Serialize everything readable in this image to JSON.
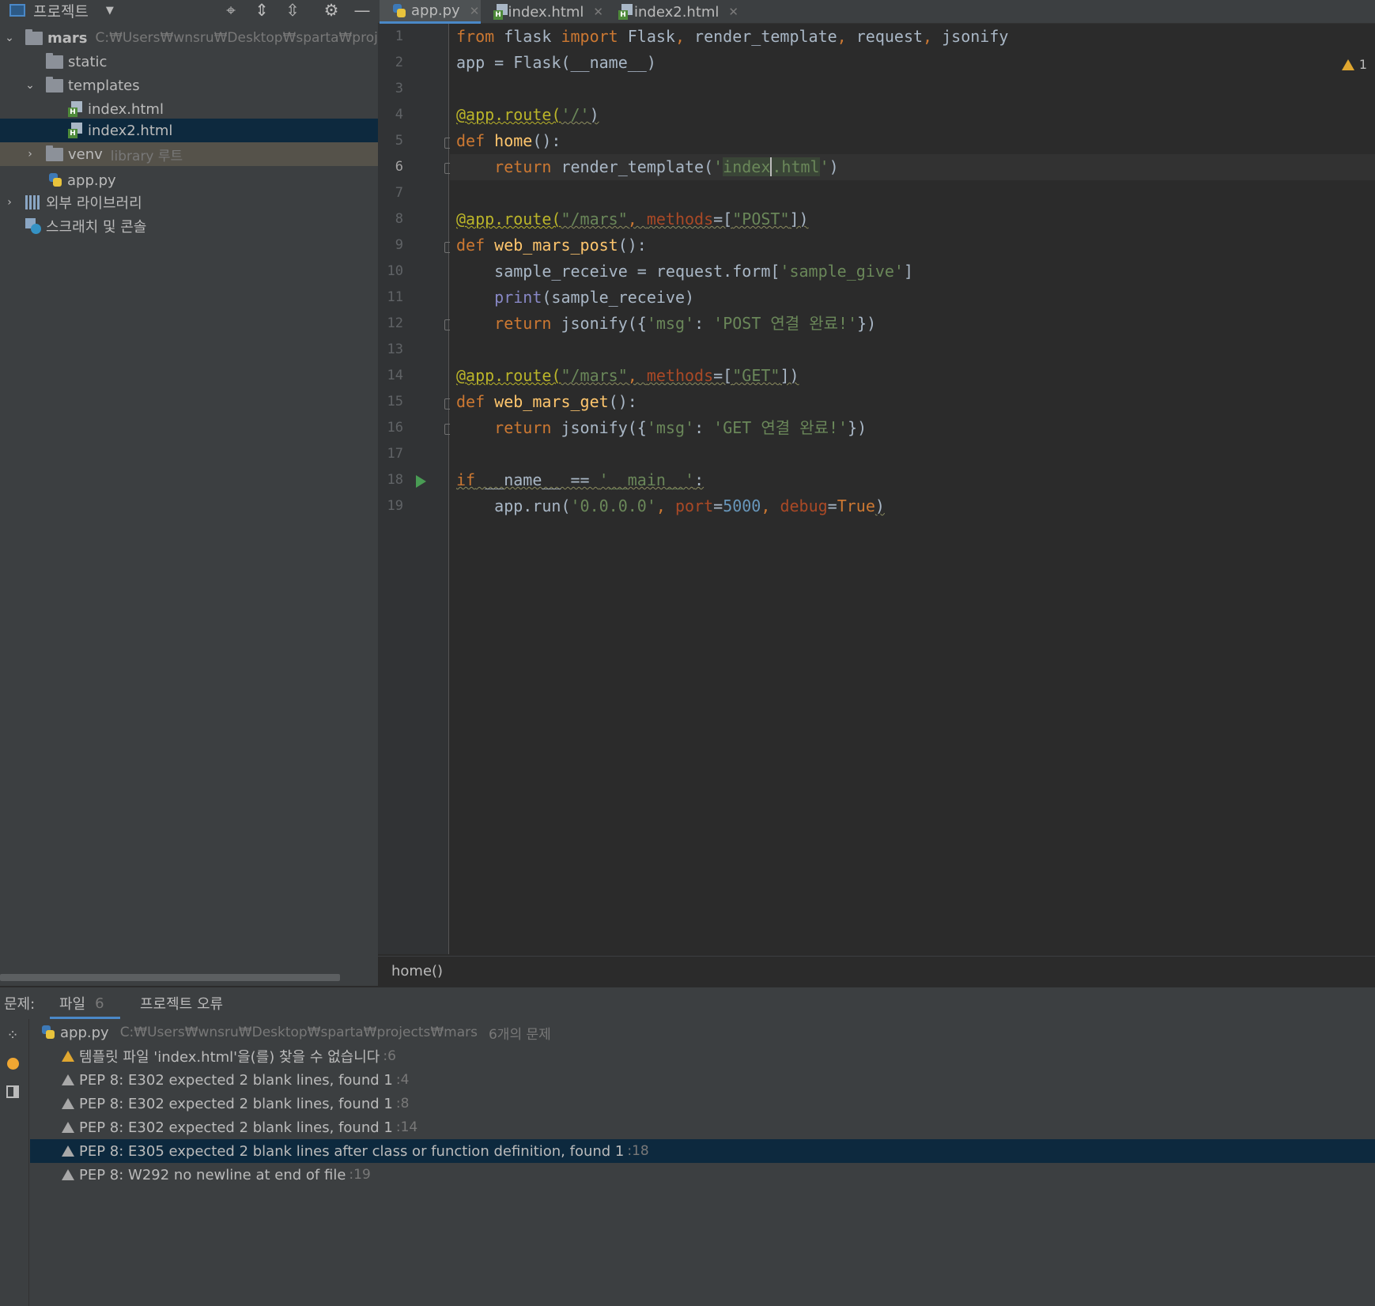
{
  "project_panel": {
    "title": "프로젝트",
    "tree": {
      "root_name": "mars",
      "root_path": "C:₩Users₩wnsru₩Desktop₩sparta₩projects₩",
      "static": "static",
      "templates": "templates",
      "index_html": "index.html",
      "index2_html": "index2.html",
      "venv": "venv",
      "venv_note": "library 루트",
      "app_py": "app.py",
      "external_libs": "외부 라이브러리",
      "scratches": "스크래치 및 콘솔"
    }
  },
  "editor": {
    "tabs": [
      "app.py",
      "index.html",
      "index2.html"
    ],
    "active_tab": "app.py",
    "warning_count": "1",
    "line_numbers": [
      "1",
      "2",
      "3",
      "4",
      "5",
      "6",
      "7",
      "8",
      "9",
      "10",
      "11",
      "12",
      "13",
      "14",
      "15",
      "16",
      "17",
      "18",
      "19"
    ],
    "current_line": "6",
    "code": {
      "l1": {
        "from": "from",
        "mod": " flask ",
        "import": "import",
        "rest": " Flask",
        "c1": ",",
        "n1": " render_template",
        "c2": ",",
        "n2": " request",
        "c3": ",",
        "n3": " jsonify"
      },
      "l2": "app = Flask(__name__)",
      "l4": {
        "deco": "@app.route(",
        "arg": "'/'",
        "close": ")"
      },
      "l5": {
        "def": "def",
        "name": " home",
        "rest": "():"
      },
      "l6": {
        "indent": "    ",
        "ret": "return",
        "call": " render_template(",
        "q1": "'",
        "s1": "index",
        "s2": ".html",
        "q2": "'",
        "close": ")"
      },
      "l8": {
        "deco": "@app.route(",
        "arg": "\"/mars\"",
        "comma": ", ",
        "param": "methods",
        "eq": "=[",
        "val": "\"POST\"",
        "close": "])"
      },
      "l9": {
        "def": "def",
        "name": " web_mars_post",
        "rest": "():"
      },
      "l10": {
        "pre": "    sample_receive = request.form[",
        "str": "'sample_give'",
        "post": "]"
      },
      "l11": {
        "indent": "    ",
        "fn": "print",
        "rest": "(sample_receive)"
      },
      "l12": {
        "indent": "    ",
        "ret": "return",
        "call": " jsonify({",
        "key": "'msg'",
        "colon": ": ",
        "val": "'POST 연결 완료!'",
        "close": "})"
      },
      "l14": {
        "deco": "@app.route(",
        "arg": "\"/mars\"",
        "comma": ", ",
        "param": "methods",
        "eq": "=[",
        "val": "\"GET\"",
        "close": "])"
      },
      "l15": {
        "def": "def",
        "name": " web_mars_get",
        "rest": "():"
      },
      "l16": {
        "indent": "    ",
        "ret": "return",
        "call": " jsonify({",
        "key": "'msg'",
        "colon": ": ",
        "val": "'GET 연결 완료!'",
        "close": "})"
      },
      "l18": {
        "if": "if",
        "mid": " __name__ == ",
        "str": "'__main__'",
        "colon": ":"
      },
      "l19": {
        "pre": "    app.run(",
        "host": "'0.0.0.0'",
        "comma": ", ",
        "p1": "port",
        "eq1": "=",
        "port": "5000",
        "comma2": ", ",
        "p2": "debug",
        "eq2": "=",
        "val": "True",
        "close": ")"
      }
    },
    "breadcrumb": "home()"
  },
  "problems": {
    "label": "문제:",
    "tab_file": "파일",
    "tab_file_count": "6",
    "tab_project": "프로젝트 오류",
    "file_name": "app.py",
    "file_path": "C:₩Users₩wnsru₩Desktop₩sparta₩projects₩mars",
    "file_count": "6개의 문제",
    "items": [
      {
        "text": "템플릿 파일 'index.html'을(를) 찾을 수 없습니다",
        "loc": ":6"
      },
      {
        "text": "PEP 8: E302 expected 2 blank lines, found 1",
        "loc": ":4"
      },
      {
        "text": "PEP 8: E302 expected 2 blank lines, found 1",
        "loc": ":8"
      },
      {
        "text": "PEP 8: E302 expected 2 blank lines, found 1",
        "loc": ":14"
      },
      {
        "text": "PEP 8: E305 expected 2 blank lines after class or function definition, found 1",
        "loc": ":18"
      },
      {
        "text": "PEP 8: W292 no newline at end of file",
        "loc": ":19"
      }
    ]
  },
  "colors": {
    "keyword": "#cc7832",
    "string": "#6a8759",
    "decorator": "#bbb529",
    "function_name": "#ffc66d",
    "builtin": "#8888c6",
    "number": "#6897bb",
    "param": "#aa4926",
    "selection": "#0d293e",
    "accent": "#4a88c7",
    "warning": "#e0a730"
  }
}
